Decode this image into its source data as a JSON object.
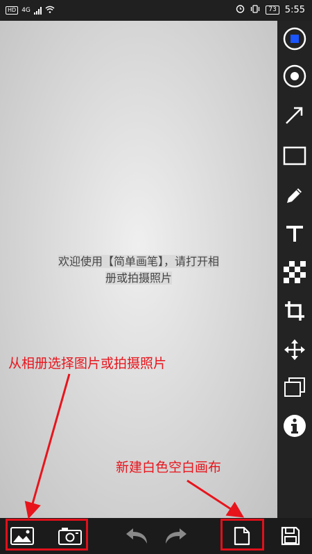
{
  "status_bar": {
    "hd_label": "HD",
    "network_label": "4G",
    "battery_level": "73",
    "time": "5:55"
  },
  "canvas": {
    "welcome_line1": "欢迎使用【简单画笔】，请打开相",
    "welcome_line2": "册或拍摄照片"
  },
  "right_toolbar": {
    "items": [
      {
        "icon": "color-picker-icon"
      },
      {
        "icon": "brush-size-icon"
      },
      {
        "icon": "arrow-tool-icon"
      },
      {
        "icon": "rectangle-tool-icon"
      },
      {
        "icon": "pencil-tool-icon"
      },
      {
        "icon": "text-tool-icon"
      },
      {
        "icon": "mosaic-tool-icon"
      },
      {
        "icon": "crop-tool-icon"
      },
      {
        "icon": "move-tool-icon"
      },
      {
        "icon": "layers-icon"
      },
      {
        "icon": "info-icon"
      }
    ]
  },
  "bottom_bar": {
    "items": [
      "gallery-icon",
      "camera-icon",
      "undo-icon",
      "redo-icon",
      "new-canvas-icon",
      "save-icon"
    ]
  },
  "annotations": {
    "pick_photo": "从相册选择图片或拍摄照片",
    "new_canvas": "新建白色空白画布"
  },
  "colors": {
    "accent_red": "#e0101a",
    "toolbar_bg": "#232323",
    "selected_blue": "#1a55ff"
  }
}
